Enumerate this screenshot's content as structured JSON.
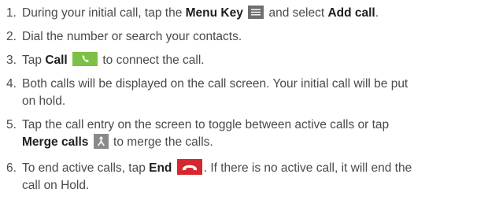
{
  "steps": [
    {
      "num": "1.",
      "before": "During your initial call, tap the ",
      "bold1": "Menu Key",
      "icon": "menu-icon",
      "middle": " and select ",
      "bold2": "Add call",
      "after": "."
    },
    {
      "num": "2.",
      "text": "Dial the number or search your contacts."
    },
    {
      "num": "3.",
      "before": "Tap ",
      "bold": "Call",
      "icon": "call-icon",
      "after": " to connect the call."
    },
    {
      "num": "4.",
      "line1": "Both calls will be displayed on the call screen. Your initial call will be put",
      "line2": "on hold."
    },
    {
      "num": "5.",
      "line1": "Tap the call entry on the screen to toggle between active calls or tap",
      "bold": "Merge calls",
      "icon": "merge-icon",
      "after": " to merge the calls."
    },
    {
      "num": "6.",
      "before": "To end active calls, tap ",
      "bold": "End",
      "icon": "end-call-icon",
      "after": ". If there is no active call, it will end the",
      "line2": "call on Hold."
    }
  ],
  "colors": {
    "text": "#4a4a4a",
    "bold": "#1f1f1f",
    "menu_icon_bg": "#6f6f6f",
    "call_icon_bg": "#7cc145",
    "merge_icon_bg": "#8a8a8a",
    "end_icon_bg": "#d6262e"
  }
}
